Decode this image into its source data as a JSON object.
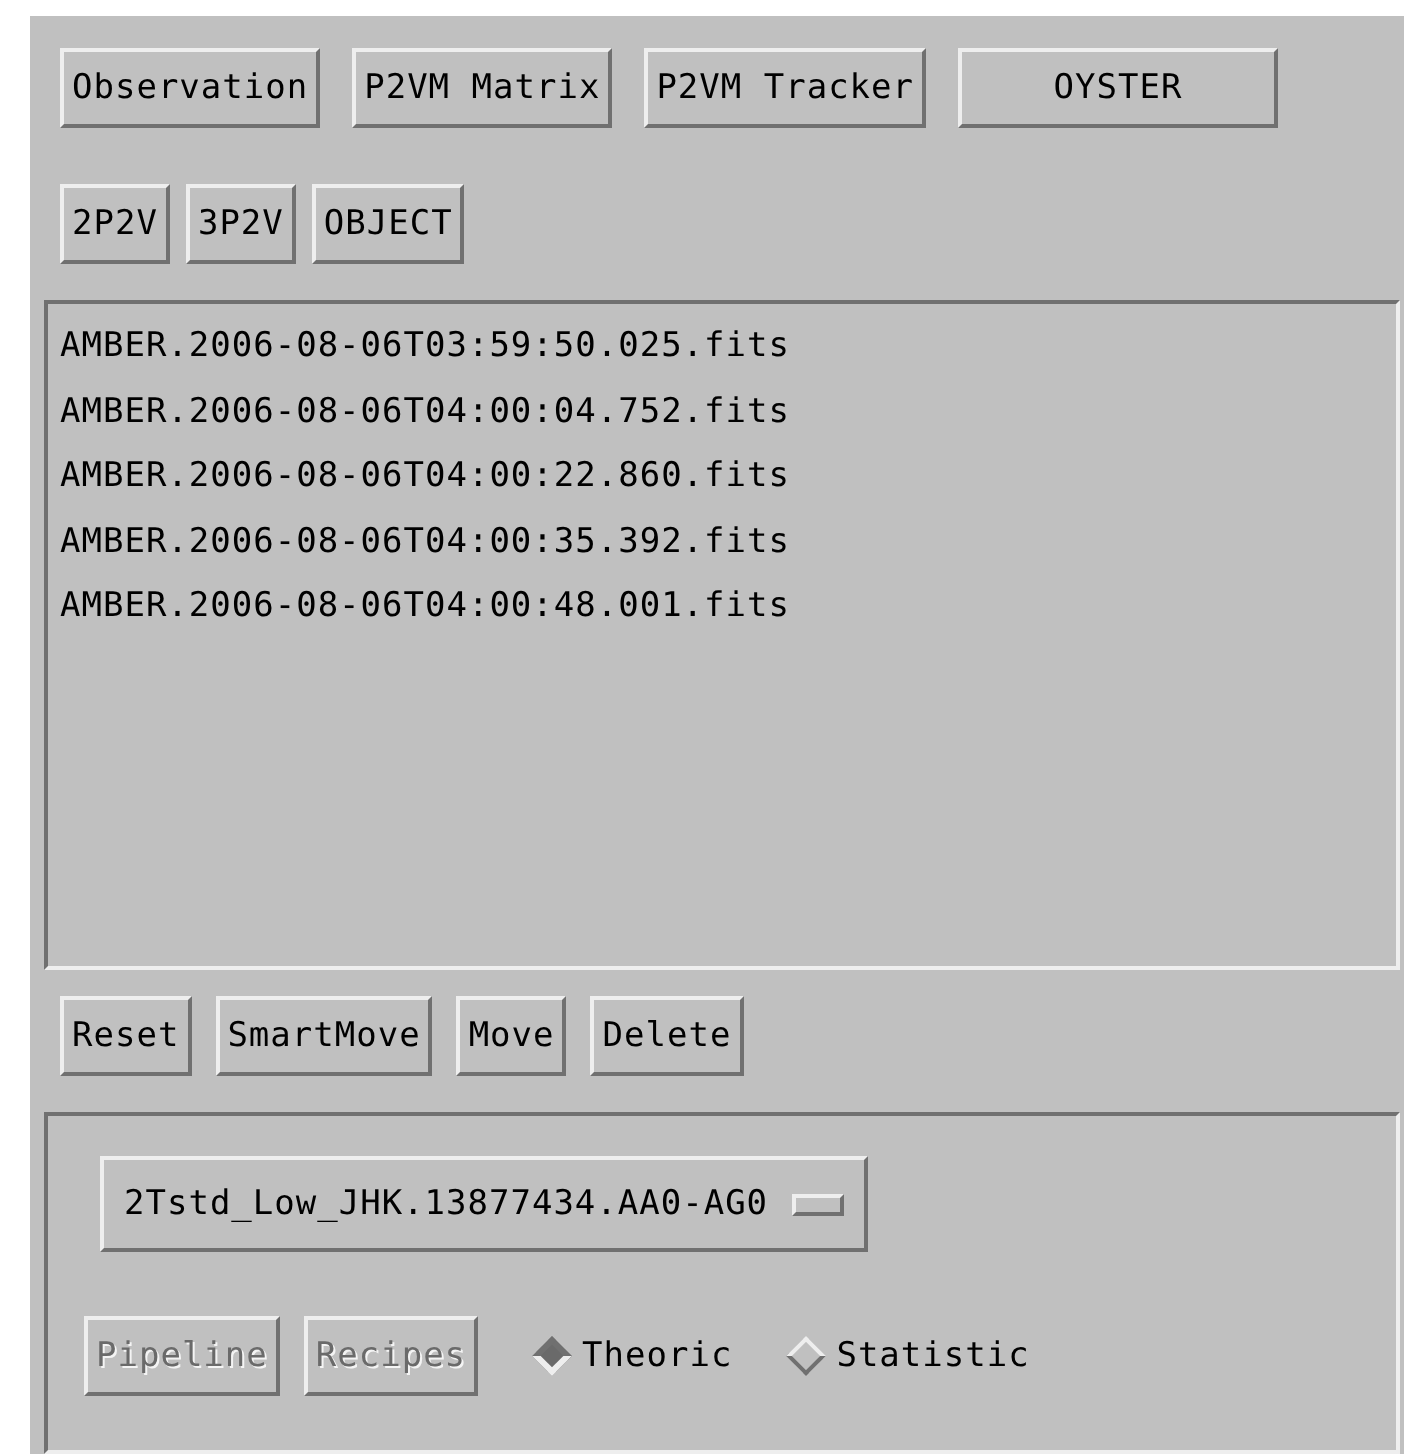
{
  "top_buttons": [
    {
      "label": "Observation"
    },
    {
      "label": "P2VM Matrix"
    },
    {
      "label": "P2VM Tracker"
    },
    {
      "label": "OYSTER",
      "wide": true
    }
  ],
  "type_buttons": [
    {
      "label": "2P2V"
    },
    {
      "label": "3P2V"
    },
    {
      "label": "OBJECT"
    }
  ],
  "file_list": [
    "AMBER.2006-08-06T03:59:50.025.fits",
    "AMBER.2006-08-06T04:00:04.752.fits",
    "AMBER.2006-08-06T04:00:22.860.fits",
    "AMBER.2006-08-06T04:00:35.392.fits",
    "AMBER.2006-08-06T04:00:48.001.fits"
  ],
  "action_buttons": [
    {
      "label": "Reset"
    },
    {
      "label": "SmartMove"
    },
    {
      "label": "Move"
    },
    {
      "label": "Delete"
    }
  ],
  "option_menu": {
    "value": "2Tstd_Low_JHK.13877434.AA0-AG0"
  },
  "bottom_buttons": [
    {
      "label": "Pipeline",
      "disabled": true
    },
    {
      "label": "Recipes",
      "disabled": true
    }
  ],
  "radios": [
    {
      "label": "Theoric",
      "selected": true
    },
    {
      "label": "Statistic",
      "selected": false
    }
  ]
}
